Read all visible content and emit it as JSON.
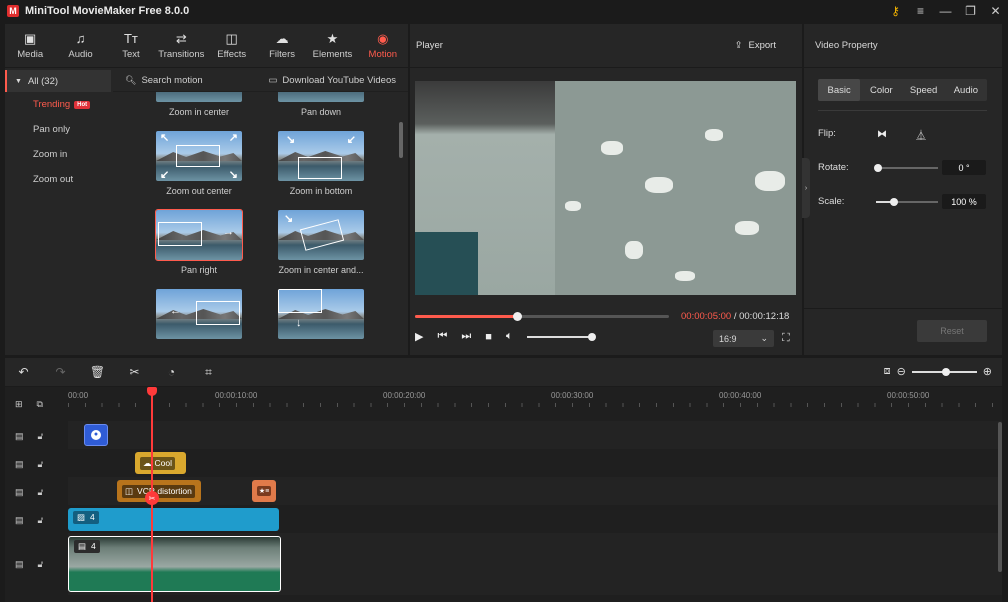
{
  "window": {
    "title": "MiniTool MovieMaker Free 8.0.0",
    "logo": "M"
  },
  "window_controls": [
    "key-icon",
    "menu-icon",
    "minimize-icon",
    "maximize-icon",
    "close-icon"
  ],
  "tabs": [
    {
      "label": "Media",
      "icon": "▣"
    },
    {
      "label": "Audio",
      "icon": "♫"
    },
    {
      "label": "Text",
      "icon": "Tт"
    },
    {
      "label": "Transitions",
      "icon": "⇄"
    },
    {
      "label": "Effects",
      "icon": "◫"
    },
    {
      "label": "Filters",
      "icon": "☁"
    },
    {
      "label": "Elements",
      "icon": "★"
    },
    {
      "label": "Motion",
      "icon": "◉",
      "active": true
    }
  ],
  "categories": {
    "all_label": "All (32)",
    "items": [
      {
        "label": "Trending",
        "badge": "Hot",
        "active": true
      },
      {
        "label": "Pan only"
      },
      {
        "label": "Zoom in"
      },
      {
        "label": "Zoom out"
      }
    ]
  },
  "motion": {
    "search_placeholder": "Search motion",
    "download_label": "Download YouTube Videos",
    "thumbs": [
      {
        "label": "Zoom in center"
      },
      {
        "label": "Pan down"
      },
      {
        "label": "Zoom out center"
      },
      {
        "label": "Zoom in bottom"
      },
      {
        "label": "Pan right",
        "selected": true
      },
      {
        "label": "Zoom in center and..."
      },
      {
        "label": ""
      },
      {
        "label": ""
      }
    ]
  },
  "player": {
    "title": "Player",
    "export_label": "Export",
    "current_time": "00:00:05:00",
    "separator": " / ",
    "total_time": "00:00:12:18",
    "progress": 0.4,
    "volume": 1.0,
    "aspect_ratio": "16:9"
  },
  "properties": {
    "title": "Video Property",
    "tabs": [
      "Basic",
      "Color",
      "Speed",
      "Audio"
    ],
    "active_tab": "Basic",
    "flip_label": "Flip:",
    "rotate_label": "Rotate:",
    "rotate_value": "0 °",
    "scale_label": "Scale:",
    "scale_value": "100 %",
    "reset_label": "Reset"
  },
  "timeline": {
    "ticks": [
      "00:00",
      "00:00:10:00",
      "00:00:20:00",
      "00:00:30:00",
      "00:00:40:00",
      "00:00:50:00"
    ],
    "clips": {
      "filter_label": "Cool",
      "effect_label": "VCR distortion",
      "image_label": "4",
      "video_label": "4"
    },
    "zoom_level": 0.5
  },
  "colors": {
    "accent": "#ff5b4d",
    "element_clip": "#2f5cd6",
    "filter_clip": "#d9a82e",
    "effect_clip": "#b8741c",
    "motion_clip": "#e07a4a",
    "image_clip": "#1f9ccc",
    "video_clip": "#1f7a55"
  }
}
